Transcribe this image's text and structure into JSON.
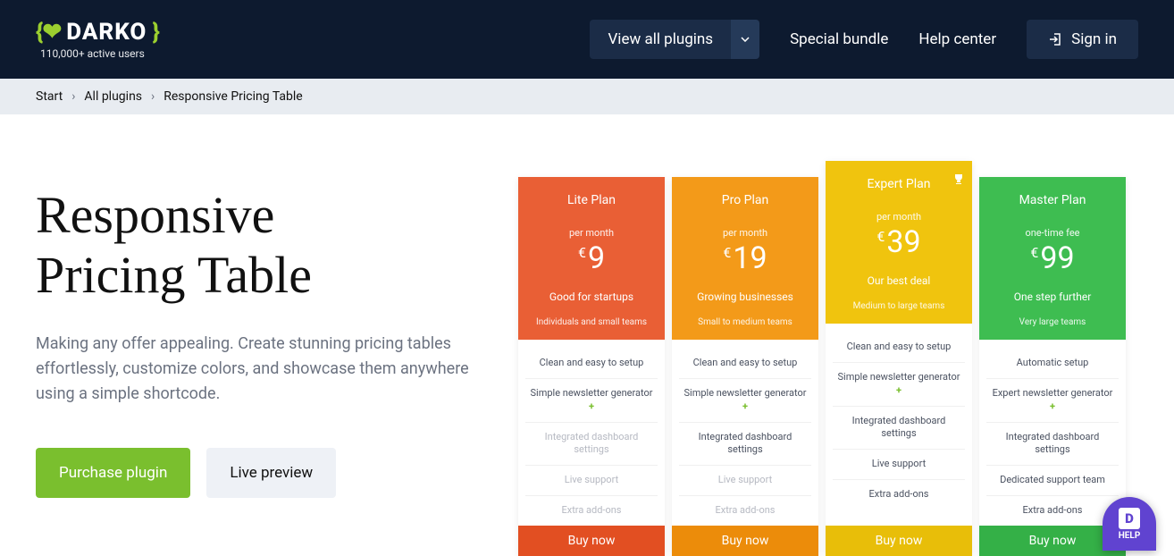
{
  "logo": {
    "brace_left": "{❤",
    "text": "DARKO",
    "brace_right": "}",
    "sub": "110,000+ active users"
  },
  "nav": {
    "view_all": "View all plugins",
    "special": "Special bundle",
    "help": "Help center",
    "signin": "Sign in"
  },
  "breadcrumb": {
    "start": "Start",
    "all": "All plugins",
    "current": "Responsive Pricing Table"
  },
  "hero": {
    "title_line1": "Responsive",
    "title_line2": "Pricing Table",
    "desc": "Making any offer appealing. Create stunning pricing tables effortlessly, customize colors, and showcase them anywhere using a simple shortcode.",
    "cta1": "Purchase plugin",
    "cta2": "Live preview"
  },
  "plans": [
    {
      "id": "lite",
      "name": "Lite Plan",
      "period": "per month",
      "currency": "€",
      "amount": "9",
      "desc": "Good for startups",
      "sub": "Individuals and small teams",
      "head_color": "#e95f35",
      "buy_color": "#e24f22",
      "features": [
        {
          "text": "Clean and easy to setup",
          "muted": false,
          "plus": false
        },
        {
          "text": "Simple newsletter generator",
          "muted": false,
          "plus": true
        },
        {
          "text": "Integrated dashboard settings",
          "muted": true,
          "plus": false
        },
        {
          "text": "Live support",
          "muted": true,
          "plus": false
        },
        {
          "text": "Extra add-ons",
          "muted": true,
          "plus": false
        }
      ],
      "buy": "Buy now"
    },
    {
      "id": "pro",
      "name": "Pro Plan",
      "period": "per month",
      "currency": "€",
      "amount": "19",
      "desc": "Growing businesses",
      "sub": "Small to medium teams",
      "head_color": "#f39a19",
      "buy_color": "#ec8c0a",
      "features": [
        {
          "text": "Clean and easy to setup",
          "muted": false,
          "plus": false
        },
        {
          "text": "Simple newsletter generator",
          "muted": false,
          "plus": true
        },
        {
          "text": "Integrated dashboard settings",
          "muted": false,
          "plus": false
        },
        {
          "text": "Live support",
          "muted": true,
          "plus": false
        },
        {
          "text": "Extra add-ons",
          "muted": true,
          "plus": false
        }
      ],
      "buy": "Buy now"
    },
    {
      "id": "expert",
      "name": "Expert Plan",
      "period": "per month",
      "currency": "€",
      "amount": "39",
      "desc": "Our best deal",
      "sub": "Medium to large teams",
      "head_color": "#f0c40e",
      "buy_color": "#e8be09",
      "featured": true,
      "features": [
        {
          "text": "Clean and easy to setup",
          "muted": false,
          "plus": false
        },
        {
          "text": "Simple newsletter generator",
          "muted": false,
          "plus": true
        },
        {
          "text": "Integrated dashboard settings",
          "muted": false,
          "plus": false
        },
        {
          "text": "Live support",
          "muted": false,
          "plus": false
        },
        {
          "text": "Extra add-ons",
          "muted": false,
          "plus": false
        }
      ],
      "buy": "Buy now"
    },
    {
      "id": "master",
      "name": "Master Plan",
      "period": "one-time fee",
      "currency": "€",
      "amount": "99",
      "desc": "One step further",
      "sub": "Very large teams",
      "head_color": "#3ebd51",
      "buy_color": "#34b047",
      "features": [
        {
          "text": "Automatic setup",
          "muted": false,
          "plus": false
        },
        {
          "text": "Expert newsletter generator",
          "muted": false,
          "plus": true
        },
        {
          "text": "Integrated dashboard settings",
          "muted": false,
          "plus": false
        },
        {
          "text": "Dedicated support team",
          "muted": false,
          "plus": false
        },
        {
          "text": "Extra add-ons",
          "muted": false,
          "plus": false
        }
      ],
      "buy": "Buy now"
    }
  ],
  "help": {
    "letter": "D",
    "label": "HELP"
  }
}
